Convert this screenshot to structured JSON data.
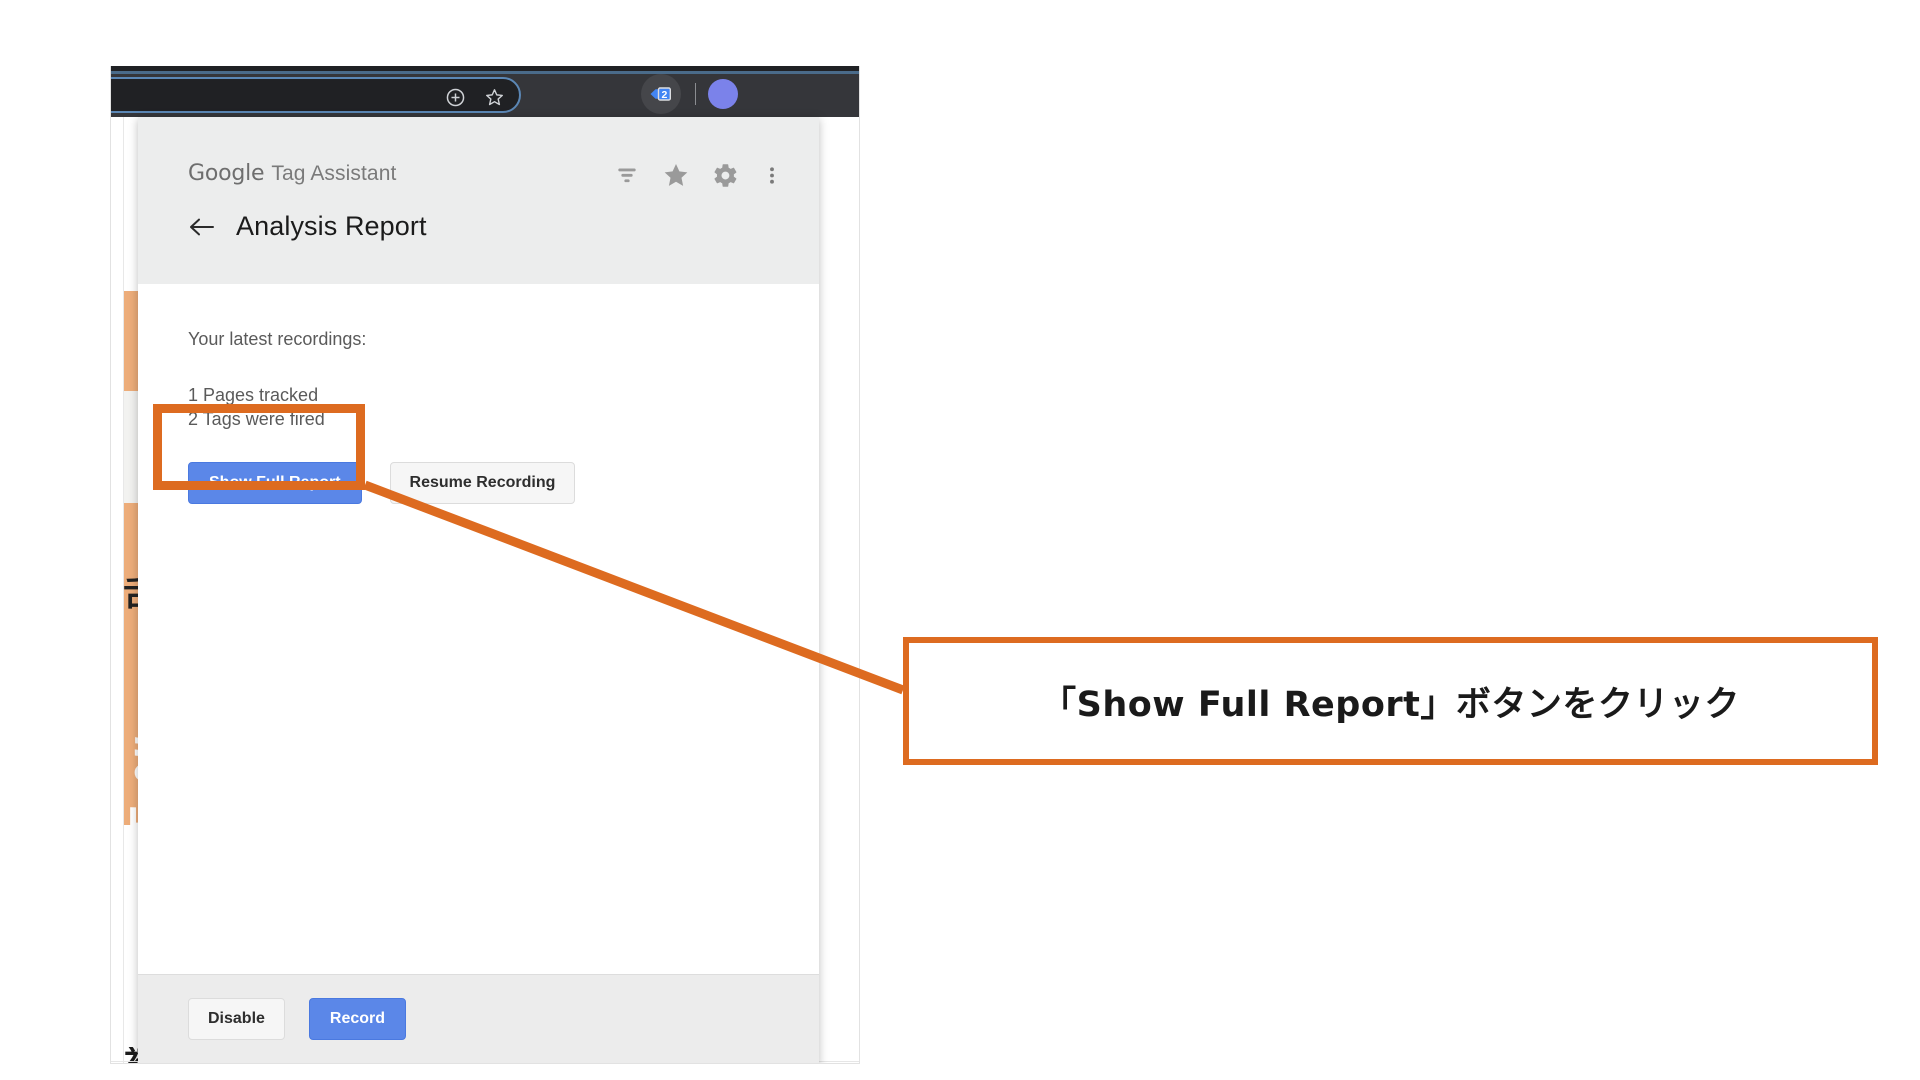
{
  "browser": {
    "omnibox": {
      "value": "",
      "icons": [
        {
          "name": "install-app-icon",
          "glyph": "plus-circle"
        },
        {
          "name": "bookmark-star-icon",
          "glyph": "star-outline"
        }
      ]
    },
    "extension_badge": {
      "name": "tag-assistant-extension-icon",
      "count": "2",
      "color": "#4285f4"
    }
  },
  "underlying_page": {
    "glyphs": [
      "舌",
      "ま",
      "版",
      "初"
    ]
  },
  "popup": {
    "brand": {
      "google": "Google",
      "product": "Tag Assistant"
    },
    "header_actions": [
      {
        "name": "filter-icon",
        "label": "Filter"
      },
      {
        "name": "star-icon",
        "label": "Favorite"
      },
      {
        "name": "gear-icon",
        "label": "Settings"
      },
      {
        "name": "more-vert-icon",
        "label": "More options"
      }
    ],
    "back_label": "Back",
    "view_title": "Analysis Report",
    "body": {
      "recordings_label": "Your latest recordings:",
      "stat_pages": "1 Pages tracked",
      "stat_tags": "2 Tags were fired",
      "primary_action": "Show Full Report",
      "secondary_action": "Resume Recording"
    },
    "footer": {
      "disable_label": "Disable",
      "record_label": "Record"
    }
  },
  "annotation": {
    "callout_text": "「Show Full Report」ボタンをクリック",
    "accent_color": "#dd6b20"
  }
}
